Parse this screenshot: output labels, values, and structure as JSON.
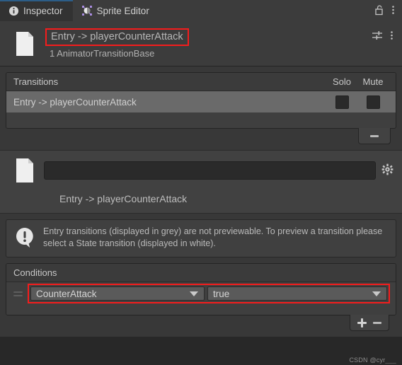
{
  "window": {
    "tabs": [
      {
        "label": "Inspector",
        "icon": "info-icon",
        "active": true
      },
      {
        "label": "Sprite Editor",
        "icon": "sprite-editor-icon",
        "active": false
      }
    ],
    "lock_icon": "unlocked-padlock-icon",
    "menu_icon": "kebab-menu-icon"
  },
  "object_header": {
    "doc_icon": "document-icon",
    "title": "Entry -> playerCounterAttack",
    "subtitle": "1 AnimatorTransitionBase",
    "preset_icon": "preset-sliders-icon",
    "menu_icon": "kebab-menu-icon",
    "highlight_color": "#f51c1c"
  },
  "transitions": {
    "header": "Transitions",
    "col_solo": "Solo",
    "col_mute": "Mute",
    "rows": [
      {
        "label": "Entry -> playerCounterAttack",
        "solo": false,
        "mute": false
      }
    ],
    "remove_button": "–"
  },
  "preview": {
    "doc_icon": "document-icon",
    "name_field_value": "",
    "name_field_placeholder": "",
    "settings_icon": "gear-icon",
    "caption": "Entry -> playerCounterAttack"
  },
  "help": {
    "icon": "info-bubble-icon",
    "message": "Entry transitions (displayed in grey) are not previewable. To preview a transition please select a State transition (displayed in white)."
  },
  "conditions": {
    "header": "Conditions",
    "rows": [
      {
        "parameter": "CounterAttack",
        "value": "true",
        "drag_handle": "drag-handle-icon"
      }
    ],
    "add_button": "+",
    "remove_button": "–",
    "highlight_color": "#f51c1c"
  },
  "watermark": {
    "text": "CSDN @cyr",
    "tail": "___"
  }
}
